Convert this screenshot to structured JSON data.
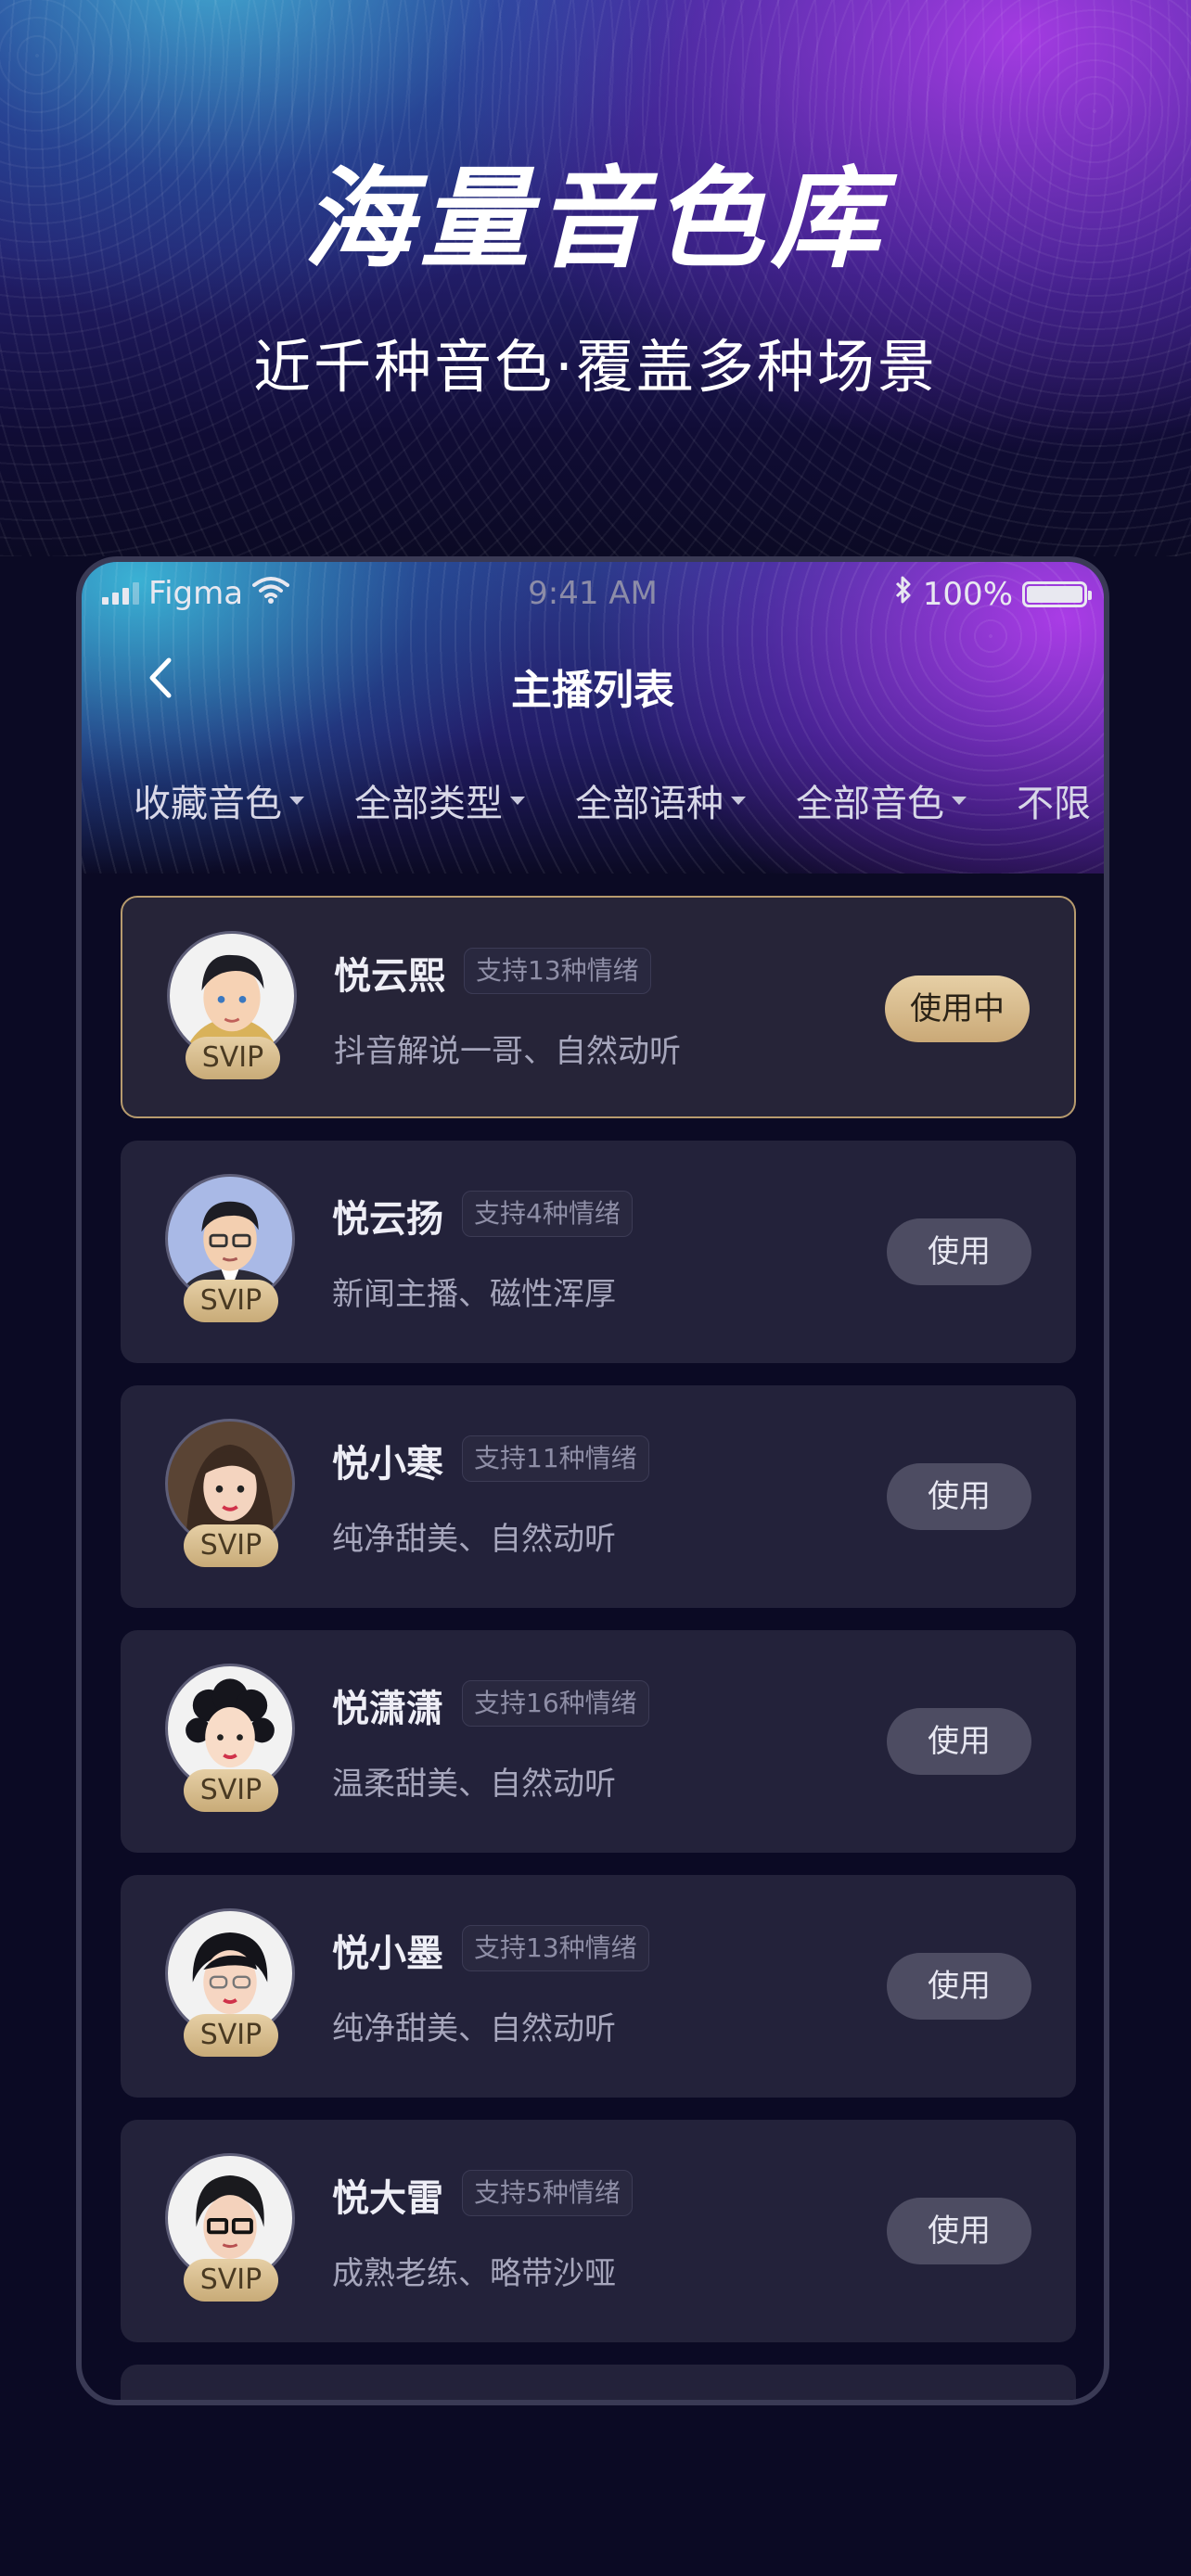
{
  "hero": {
    "title": "海量音色库",
    "subtitle": "近千种音色·覆盖多种场景"
  },
  "status_bar": {
    "carrier": "Figma",
    "time": "9:41 AM",
    "battery": "100%"
  },
  "nav": {
    "title": "主播列表"
  },
  "filters": [
    {
      "label": "收藏音色"
    },
    {
      "label": "全部类型"
    },
    {
      "label": "全部语种"
    },
    {
      "label": "全部音色"
    },
    {
      "label": "不限"
    }
  ],
  "voices": [
    {
      "name": "悦云熙",
      "emotions": "支持13种情绪",
      "desc": "抖音解说一哥、自然动听",
      "badge": "SVIP",
      "button": "使用中",
      "active": true
    },
    {
      "name": "悦云扬",
      "emotions": "支持4种情绪",
      "desc": "新闻主播、磁性浑厚",
      "badge": "SVIP",
      "button": "使用",
      "active": false
    },
    {
      "name": "悦小寒",
      "emotions": "支持11种情绪",
      "desc": "纯净甜美、自然动听",
      "badge": "SVIP",
      "button": "使用",
      "active": false
    },
    {
      "name": "悦潇潇",
      "emotions": "支持16种情绪",
      "desc": "温柔甜美、自然动听",
      "badge": "SVIP",
      "button": "使用",
      "active": false
    },
    {
      "name": "悦小墨",
      "emotions": "支持13种情绪",
      "desc": "纯净甜美、自然动听",
      "badge": "SVIP",
      "button": "使用",
      "active": false
    },
    {
      "name": "悦大雷",
      "emotions": "支持5种情绪",
      "desc": "成熟老练、略带沙哑",
      "badge": "SVIP",
      "button": "使用",
      "active": false
    }
  ],
  "colors": {
    "accent_gold": "#c8ab78",
    "card_bg": "#23223a",
    "page_bg": "#0b0a24"
  }
}
